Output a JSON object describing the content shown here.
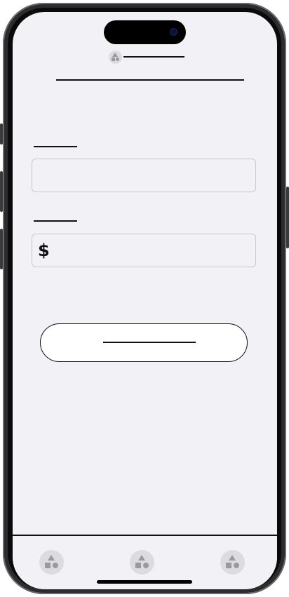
{
  "status_bar": {
    "app_icon": "shapes-placeholder-icon",
    "title_text": ""
  },
  "header": {
    "title": ""
  },
  "form": {
    "field_one": {
      "label": "",
      "value": "",
      "placeholder": ""
    },
    "field_two": {
      "label": "",
      "currency_symbol": "$",
      "value": "",
      "placeholder": ""
    }
  },
  "primary_button": {
    "label": ""
  },
  "tab_bar": {
    "items": [
      {
        "icon": "shapes-placeholder-icon",
        "label": ""
      },
      {
        "icon": "shapes-placeholder-icon",
        "label": ""
      },
      {
        "icon": "shapes-placeholder-icon",
        "label": ""
      }
    ]
  },
  "colors": {
    "screen_background": "#f2f1f6",
    "field_border": "#c8c8cc",
    "placeholder_icon_bg": "#dcdce0",
    "placeholder_icon_fg": "#9a9a9e",
    "ink": "#111111"
  }
}
